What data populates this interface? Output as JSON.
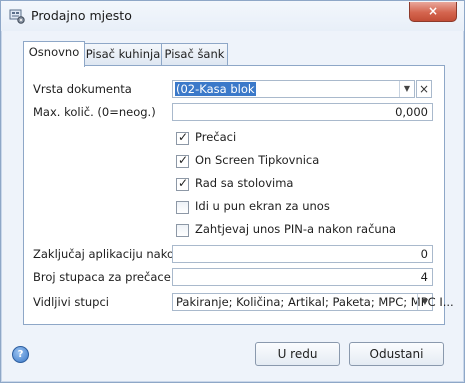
{
  "window": {
    "title": "Prodajno mjesto",
    "close_label": "×"
  },
  "tabs": [
    {
      "label": "Osnovno",
      "active": true
    },
    {
      "label": "Pisač kuhinja",
      "active": false
    },
    {
      "label": "Pisač šank",
      "active": false
    }
  ],
  "form": {
    "vrsta_label": "Vrsta dokumenta",
    "vrsta_value": "(02-Kasa blok",
    "max_label": "Max. količ. (0=neog.)",
    "max_value": "0,000",
    "checkboxes": [
      {
        "label": "Prečaci",
        "checked": true
      },
      {
        "label": "On Screen Tipkovnica",
        "checked": true
      },
      {
        "label": "Rad sa stolovima",
        "checked": true
      },
      {
        "label": "Idi u pun ekran za unos",
        "checked": false
      },
      {
        "label": "Zahtjevaj unos PIN-a nakon računa",
        "checked": false
      }
    ],
    "lock_label": "Zaključaj aplikaciju nakon (s)",
    "lock_value": "0",
    "cols_label": "Broj stupaca za prečace",
    "cols_value": "4",
    "visible_label": "Vidljivi stupci",
    "visible_value": "Pakiranje; Količina; Artikal; Paketa; MPC; MPC I..."
  },
  "footer": {
    "ok_label": "U redu",
    "cancel_label": "Odustani",
    "help_glyph": "?"
  },
  "icons": {
    "clear": "×",
    "dropdown": "▼",
    "check": "✓"
  },
  "colors": {
    "accent": "#3b79c9",
    "border": "#8ea7c7",
    "close": "#c24d36"
  }
}
